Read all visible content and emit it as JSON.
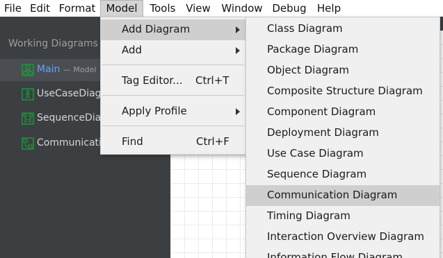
{
  "menubar": {
    "items": [
      {
        "label": "File"
      },
      {
        "label": "Edit"
      },
      {
        "label": "Format"
      },
      {
        "label": "Model"
      },
      {
        "label": "Tools"
      },
      {
        "label": "View"
      },
      {
        "label": "Window"
      },
      {
        "label": "Debug"
      },
      {
        "label": "Help"
      }
    ]
  },
  "sidebar": {
    "title": "Working Diagrams",
    "items": [
      {
        "name": "Main",
        "meta": "— Model",
        "icon": "class-diagram-icon",
        "selected": true
      },
      {
        "name": "UseCaseDiagram",
        "icon": "use-case-diagram-icon"
      },
      {
        "name": "SequenceDiagram",
        "icon": "sequence-diagram-icon"
      },
      {
        "name": "CommunicationDiagram",
        "icon": "communication-diagram-icon"
      }
    ]
  },
  "model_menu": {
    "items": [
      {
        "label": "Add Diagram",
        "has_submenu": true,
        "highlighted": true
      },
      {
        "label": "Add",
        "has_submenu": true
      },
      {
        "label": "Tag Editor...",
        "shortcut": "Ctrl+T"
      },
      {
        "label": "Apply Profile",
        "has_submenu": true
      },
      {
        "label": "Find",
        "shortcut": "Ctrl+F"
      }
    ]
  },
  "add_diagram_menu": {
    "items": [
      {
        "label": "Class Diagram"
      },
      {
        "label": "Package Diagram"
      },
      {
        "label": "Object Diagram"
      },
      {
        "label": "Composite Structure Diagram"
      },
      {
        "label": "Component Diagram"
      },
      {
        "label": "Deployment Diagram"
      },
      {
        "label": "Use Case Diagram"
      },
      {
        "label": "Sequence Diagram"
      },
      {
        "label": "Communication Diagram",
        "highlighted": true
      },
      {
        "label": "Timing Diagram"
      },
      {
        "label": "Interaction Overview Diagram"
      },
      {
        "label": "Information Flow Diagram"
      }
    ]
  },
  "colors": {
    "sidebar_bg": "#3b3f42",
    "selected_text": "#5fa4ff",
    "icon_green": "#1a9c3a",
    "menu_bg": "#f0f0f0",
    "menu_highlight": "#cfcfcf"
  }
}
